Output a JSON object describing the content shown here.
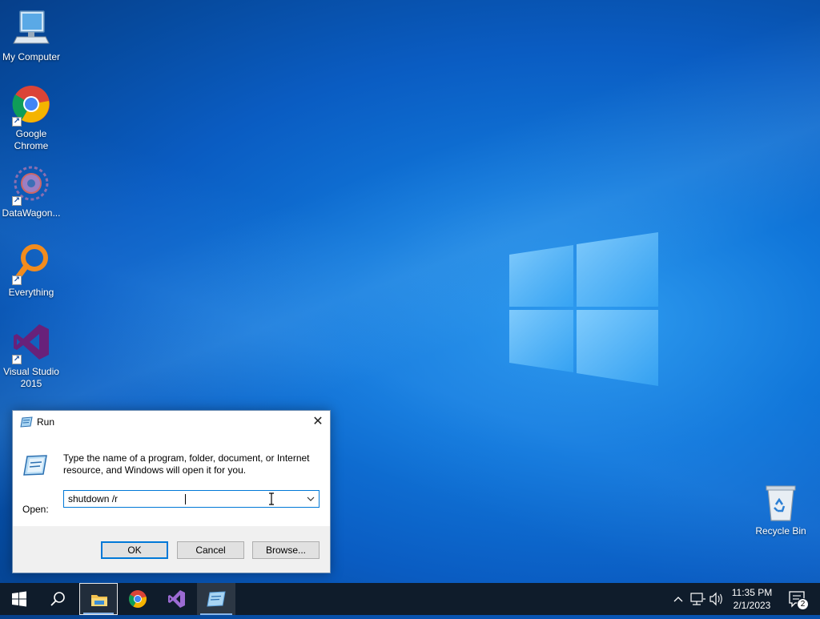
{
  "desktop": {
    "icons": [
      {
        "label": "My Computer",
        "icon": "computer-icon"
      },
      {
        "label": "Google Chrome",
        "icon": "chrome-icon"
      },
      {
        "label": "DataWagon...",
        "icon": "datawagon-icon"
      },
      {
        "label": "Everything",
        "icon": "everything-search-icon"
      },
      {
        "label": "Visual Studio 2015",
        "icon": "visual-studio-icon"
      },
      {
        "label": "Recycle Bin",
        "icon": "recycle-bin-icon"
      }
    ]
  },
  "run_dialog": {
    "title": "Run",
    "description": "Type the name of a program, folder, document, or Internet resource, and Windows will open it for you.",
    "open_label": "Open:",
    "command_value": "shutdown /r",
    "buttons": {
      "ok": "OK",
      "cancel": "Cancel",
      "browse": "Browse..."
    }
  },
  "taskbar": {
    "items": [
      "start-icon",
      "search-icon",
      "file-explorer-icon",
      "chrome-icon",
      "visual-studio-icon",
      "run-icon"
    ],
    "clock": {
      "time": "11:35 PM",
      "date": "2/1/2023"
    },
    "notification_count": "2"
  },
  "colors": {
    "accent": "#0078d7",
    "taskbar": "#0f1c2b",
    "desktop": "#0a5cc2"
  }
}
